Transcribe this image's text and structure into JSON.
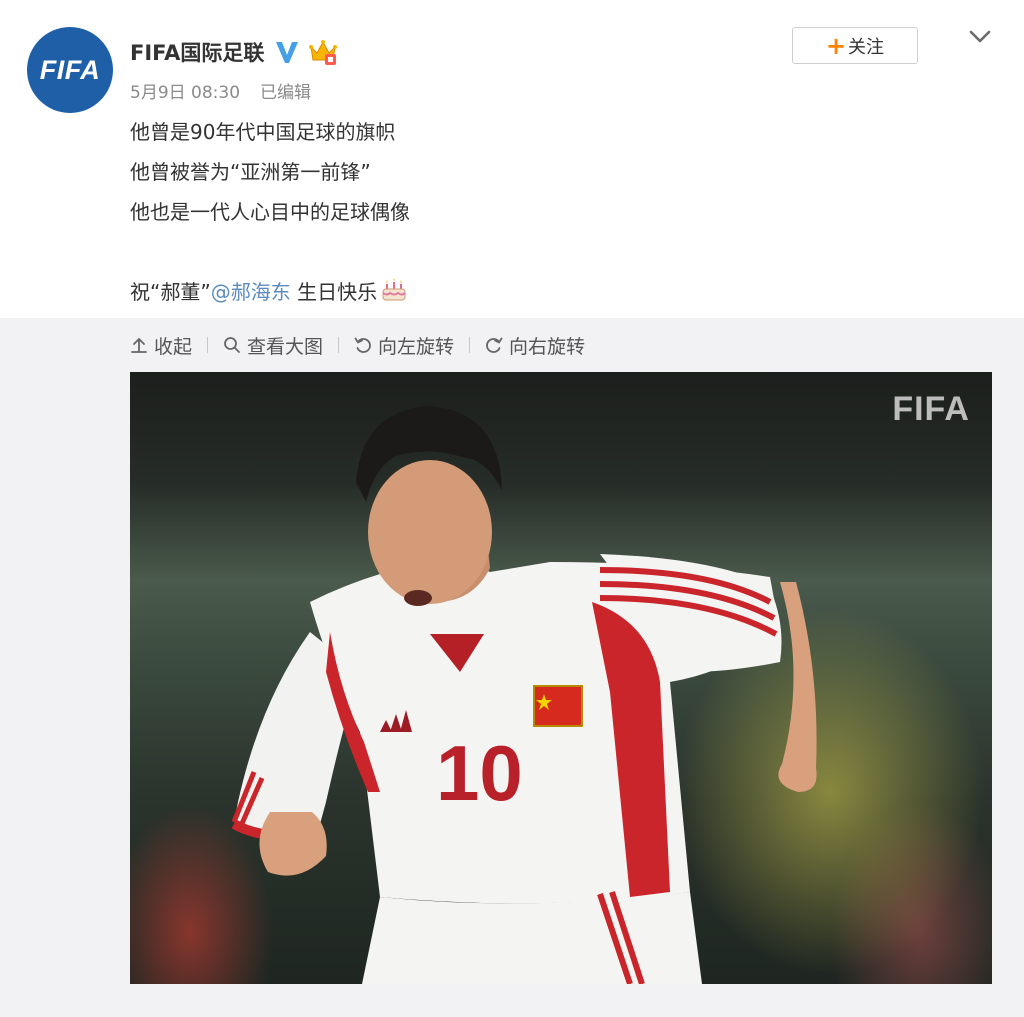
{
  "account": {
    "avatar_text": "FIFA",
    "name": "FIFA国际足联",
    "verified_icon": "verified-v-icon",
    "member_icon": "crown-member-icon"
  },
  "meta": {
    "timestamp": "5月9日 08:30",
    "edited": "已编辑"
  },
  "follow": {
    "plus": "+",
    "label": "关注"
  },
  "content": {
    "lines": [
      "他曾是90年代中国足球的旗帜",
      "他曾被誉为“亚洲第一前锋”",
      "他也是一代人心目中的足球偶像"
    ],
    "wish_prefix": "祝“郝董”",
    "mention": "@郝海东",
    "wish_suffix": " 生日快乐"
  },
  "toolbar": {
    "collapse": "收起",
    "view_large": "查看大图",
    "rotate_left": "向左旋转",
    "rotate_right": "向右旋转"
  },
  "photo": {
    "watermark": "FIFA",
    "jersey_number": "10",
    "kit_brand": "adidas"
  },
  "colors": {
    "accent_orange": "#ff8200",
    "mention_blue": "#5b8bbf",
    "verified_blue": "#46a0e6",
    "avatar_blue": "#1f5fa8"
  }
}
